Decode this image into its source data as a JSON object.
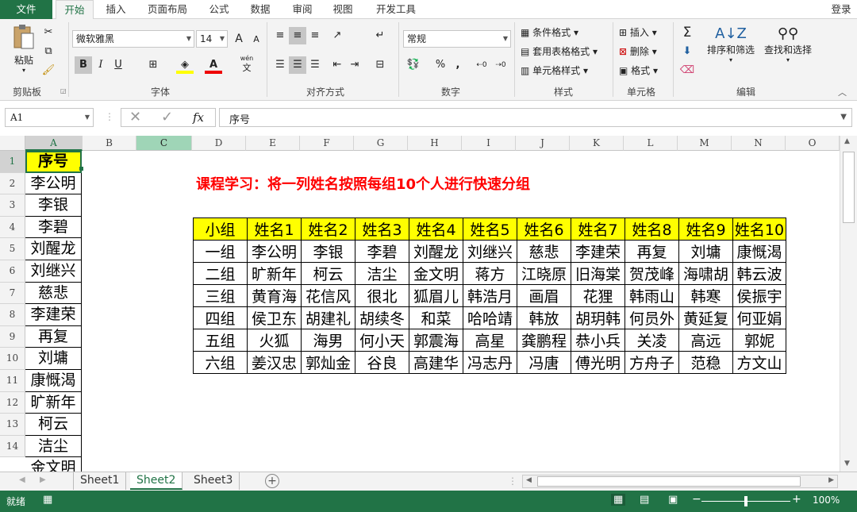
{
  "tabs": [
    "文件",
    "开始",
    "插入",
    "页面布局",
    "公式",
    "数据",
    "审阅",
    "视图",
    "开发工具"
  ],
  "login": "登录",
  "ribbon": {
    "clipboard": {
      "paste": "粘贴",
      "label": "剪贴板"
    },
    "font": {
      "name": "微软雅黑",
      "size": "14",
      "label": "字体",
      "bold": "B",
      "italic": "I",
      "underline": "U",
      "grow": "A",
      "shrink": "A",
      "wen": "wén",
      "wen_char": "文"
    },
    "align": {
      "label": "对齐方式"
    },
    "number": {
      "format": "常规",
      "label": "数字",
      "percent": "%",
      "comma": ","
    },
    "styles": {
      "cond": "条件格式",
      "table": "套用表格格式",
      "cell": "单元格样式",
      "label": "样式"
    },
    "cells": {
      "insert": "插入",
      "delete": "删除",
      "format": "格式",
      "label": "单元格"
    },
    "editing": {
      "sort": "排序和筛选",
      "find": "查找和选择",
      "label": "编辑",
      "sigma": "Σ"
    }
  },
  "formula_bar": {
    "name_box": "A1",
    "fx": "fx",
    "value": "序号"
  },
  "columns": [
    "A",
    "B",
    "C",
    "D",
    "E",
    "F",
    "G",
    "H",
    "I",
    "J",
    "K",
    "L",
    "M",
    "N",
    "O"
  ],
  "rows": [
    "1",
    "2",
    "3",
    "4",
    "5",
    "6",
    "7",
    "8",
    "9",
    "10",
    "11",
    "12",
    "13",
    "14"
  ],
  "colA": [
    "序号",
    "李公明",
    "李银",
    "李碧",
    "刘醒龙",
    "刘继兴",
    "慈悲",
    "李建荣",
    "再复",
    "刘墉",
    "康慨渴",
    "旷新年",
    "柯云",
    "洁尘",
    "金文明"
  ],
  "heading": "课程学习：将一列姓名按照每组10个人进行快速分组",
  "table": {
    "header": [
      "小组",
      "姓名1",
      "姓名2",
      "姓名3",
      "姓名4",
      "姓名5",
      "姓名6",
      "姓名7",
      "姓名8",
      "姓名9",
      "姓名10"
    ],
    "rows": [
      [
        "一组",
        "李公明",
        "李银",
        "李碧",
        "刘醒龙",
        "刘继兴",
        "慈悲",
        "李建荣",
        "再复",
        "刘墉",
        "康慨渴"
      ],
      [
        "二组",
        "旷新年",
        "柯云",
        "洁尘",
        "金文明",
        "蒋方",
        "江晓原",
        "旧海棠",
        "贺茂峰",
        "海啸胡",
        "韩云波"
      ],
      [
        "三组",
        "黄育海",
        "花信风",
        "很北",
        "狐眉儿",
        "韩浩月",
        "画眉",
        "花狸",
        "韩雨山",
        "韩寒",
        "侯振宇"
      ],
      [
        "四组",
        "侯卫东",
        "胡建礼",
        "胡续冬",
        "和菜",
        "哈哈靖",
        "韩放",
        "胡玥韩",
        "何员外",
        "黄延复",
        "何亚娟"
      ],
      [
        "五组",
        "火狐",
        "海男",
        "何小天",
        "郭震海",
        "高星",
        "龚鹏程",
        "恭小兵",
        "关凌",
        "高远",
        "郭妮"
      ],
      [
        "六组",
        "姜汉忠",
        "郭灿金",
        "谷良",
        "高建华",
        "冯志丹",
        "冯唐",
        "傅光明",
        "方舟子",
        "范稳",
        "方文山"
      ]
    ]
  },
  "sheets": [
    "Sheet1",
    "Sheet2",
    "Sheet3"
  ],
  "active_sheet": "Sheet2",
  "status": {
    "ready": "就绪",
    "zoom": "100%",
    "zoom_level": 0.5
  },
  "colors": {
    "accent": "#217346",
    "highlight": "#ffff00",
    "title_red": "#ff0000"
  }
}
